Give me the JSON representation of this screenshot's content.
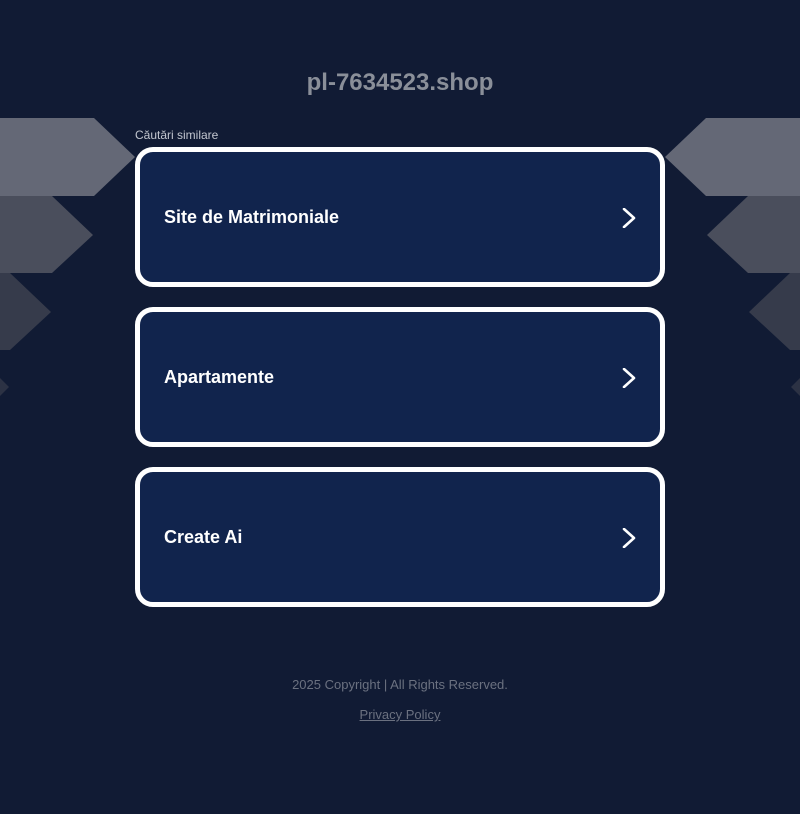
{
  "page": {
    "domain_title": "pl-7634523.shop",
    "related_searches_label": "Căutări similare"
  },
  "links": [
    {
      "label": "Site de Matrimoniale"
    },
    {
      "label": "Apartamente"
    },
    {
      "label": "Create Ai"
    }
  ],
  "footer": {
    "copyright": "2025 Copyright | All Rights Reserved.",
    "privacy_policy": "Privacy Policy"
  },
  "colors": {
    "background": "#111b34",
    "card_background": "#11244d",
    "card_border": "#ffffff",
    "title_text": "#8a8f99",
    "footer_text": "#6b7180"
  },
  "icons": {
    "card_arrow": "chevron-right-icon"
  }
}
